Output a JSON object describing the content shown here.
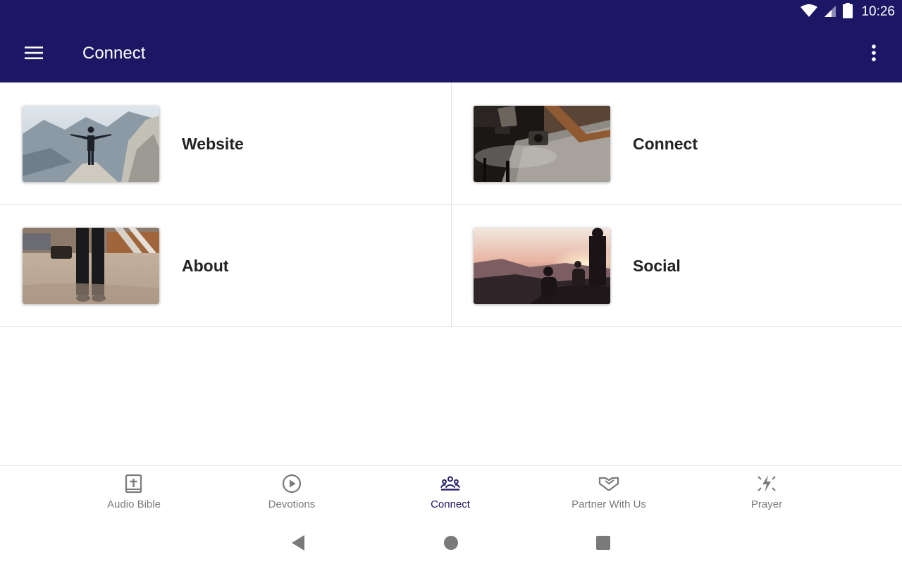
{
  "status_bar": {
    "time": "10:26",
    "icons": [
      "wifi-icon",
      "cellular-signal-icon",
      "battery-icon"
    ]
  },
  "app_bar": {
    "title": "Connect",
    "menu_icon": "hamburger-menu-icon",
    "overflow_icon": "more-vertical-icon",
    "color": "#1c1764"
  },
  "tiles": [
    {
      "label": "Website",
      "image": "person-on-mountain-cliff"
    },
    {
      "label": "Connect",
      "image": "glass-coffee-table-with-camera"
    },
    {
      "label": "About",
      "image": "person-standing-on-sand"
    },
    {
      "label": "Social",
      "image": "people-watching-sunset"
    }
  ],
  "bottom_nav": {
    "items": [
      {
        "label": "Audio Bible",
        "icon": "bible-cross-icon",
        "active": false
      },
      {
        "label": "Devotions",
        "icon": "play-circle-icon",
        "active": false
      },
      {
        "label": "Connect",
        "icon": "group-people-icon",
        "active": true
      },
      {
        "label": "Partner With Us",
        "icon": "handshake-icon",
        "active": false
      },
      {
        "label": "Prayer",
        "icon": "prayer-lightning-icon",
        "active": false
      }
    ],
    "active_color": "#1c1764",
    "inactive_color": "#7a7a7a"
  },
  "system_nav": {
    "icons": [
      "back-icon",
      "home-icon",
      "recents-icon"
    ]
  }
}
